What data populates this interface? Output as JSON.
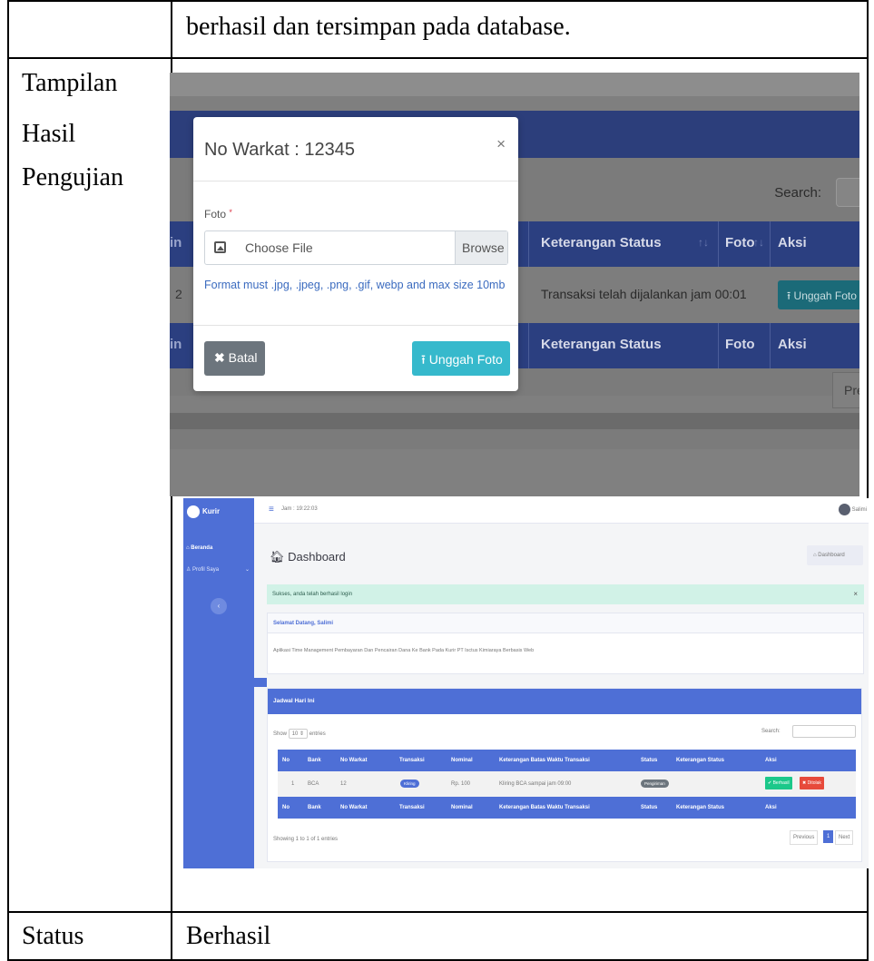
{
  "doc": {
    "top_text": "berhasil dan tersimpan pada database.",
    "label_result": [
      "Tampilan",
      "Hasil",
      "Pengujian"
    ],
    "label_status": "Status",
    "status_value": "Berhasil"
  },
  "modal": {
    "title": "No Warkat : 12345",
    "close": "×",
    "foto_label": "Foto",
    "required_mark": "*",
    "file_placeholder": "Choose File",
    "browse": "Browse",
    "hint": "Format must .jpg, .jpeg, .png, .gif, webp and max size 10mb",
    "cancel_label": "Batal",
    "upload_label": "Unggah Foto"
  },
  "bg_table": {
    "search_label": "Search:",
    "headers": [
      "Keterangan Status",
      "Foto",
      "Aksi"
    ],
    "row_text": "Transaksi telah dijalankan jam 00:01",
    "row_button": "Unggah Foto",
    "prev": "Prev",
    "partial_left": [
      "in",
      "2",
      "in"
    ]
  },
  "dashboard": {
    "brand": "Kurir",
    "nav": [
      "Beranda",
      "Profil Saya"
    ],
    "clock": "Jam : 19:22:03",
    "user": "Salimi",
    "page_title": "Dashboard",
    "breadcrumb": "Dashboard",
    "alert": "Sukses, anda telah berhasil login",
    "welcome_title": "Selamat Datang, Salimi",
    "welcome_body": "Aplikasi Time Management Pembayaran Dan Pencairan Dana Ke Bank Pada Kurir PT Isctus Kimiaraya Berbasis Web",
    "jadwal_title": "Jadwal Hari Ini",
    "show_label": "Show",
    "show_value": "10",
    "entries_label": "entries",
    "search_label": "Search:",
    "columns": [
      "No",
      "Bank",
      "No Warkat",
      "Transaksi",
      "Nominal",
      "Keterangan Batas Waktu Transaksi",
      "Status",
      "Keterangan Status",
      "Aksi"
    ],
    "rows": [
      {
        "no": "1",
        "bank": "BCA",
        "warkat": "12",
        "transaksi": "Kliring",
        "nominal": "Rp. 100",
        "keterangan": "Kliring BCA sampai jam 09:00",
        "status": "Pengiriman",
        "ket_status": ""
      }
    ],
    "btn_ok": "Berhasil",
    "btn_no": "Ditolak",
    "showing": "Showing 1 to 1 of 1 entries",
    "pager": [
      "Previous",
      "1",
      "Next"
    ]
  }
}
